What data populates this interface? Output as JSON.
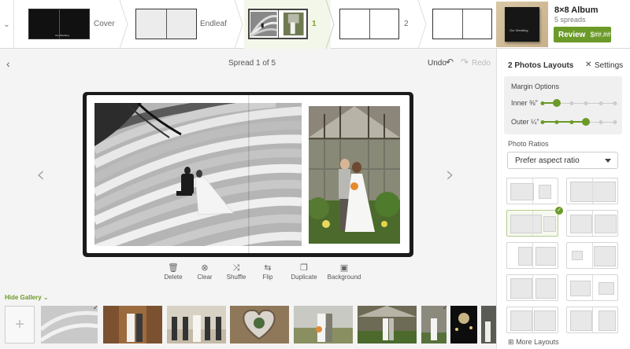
{
  "spreads": [
    {
      "label": "Cover"
    },
    {
      "label": "Endleaf"
    },
    {
      "label": "1"
    },
    {
      "label": "2"
    }
  ],
  "cover_mini_title": "Our Wedding",
  "album": {
    "title": "8×8 Album",
    "subtitle": "5 spreads",
    "review_label": "Review",
    "price": "$##.##"
  },
  "editor": {
    "spread_counter": "Spread 1 of 5",
    "undo": "Undo",
    "redo": "Redo"
  },
  "tools": [
    {
      "label": "Delete",
      "icon": "trash-icon"
    },
    {
      "label": "Clear",
      "icon": "clear-icon"
    },
    {
      "label": "Shuffle",
      "icon": "shuffle-icon"
    },
    {
      "label": "Flip",
      "icon": "flip-icon"
    },
    {
      "label": "Duplicate",
      "icon": "duplicate-icon"
    },
    {
      "label": "Background",
      "icon": "background-icon"
    }
  ],
  "panel": {
    "title": "2 Photos Layouts",
    "settings": "Settings",
    "margin_title": "Margin Options",
    "inner_label": "Inner",
    "inner_value": "⅜\"",
    "outer_label": "Outer",
    "outer_value": "¼\"",
    "ratio_label": "Photo Ratios",
    "ratio_selected": "Prefer aspect ratio",
    "more_layouts": "More Layouts"
  },
  "gallery": {
    "hide_label": "Hide Gallery"
  },
  "colors": {
    "accent": "#6b9a28"
  }
}
